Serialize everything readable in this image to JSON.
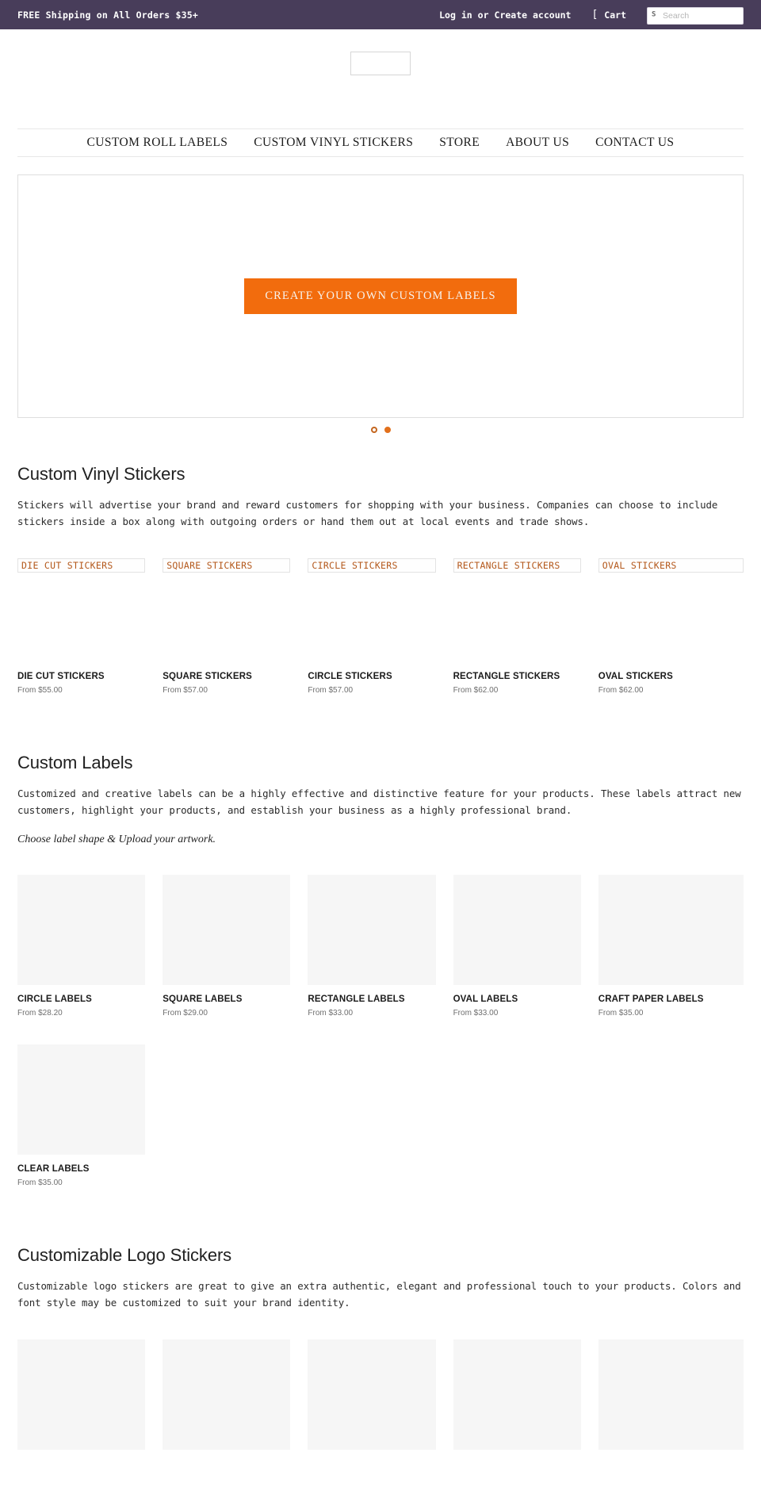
{
  "topbar": {
    "promo": "FREE Shipping on All Orders $35+",
    "login_label": "Log in",
    "separator": "or",
    "create_account_label": "Create account",
    "cart_icon": "[",
    "cart_label": "Cart",
    "search_placeholder": "Search",
    "search_value": "",
    "search_glyph": "S",
    "bg_color": "#483d5a"
  },
  "header": {
    "logo_alt": ""
  },
  "nav": {
    "items": [
      {
        "label": "CUSTOM ROLL LABELS"
      },
      {
        "label": "CUSTOM VINYL STICKERS"
      },
      {
        "label": "STORE"
      },
      {
        "label": "ABOUT US"
      },
      {
        "label": "CONTACT US"
      }
    ]
  },
  "hero": {
    "cta_label": "CREATE YOUR OWN CUSTOM LABELS",
    "cta_color": "#f26c0d",
    "dots": [
      {
        "active": false
      },
      {
        "active": true
      }
    ]
  },
  "sections": [
    {
      "title": "Custom Vinyl Stickers",
      "body": "Stickers will advertise your brand and reward customers for shopping with your business. Companies can choose to include stickers inside a box along with outgoing orders or hand them out at local events and trade shows.",
      "note": "",
      "tile_style": "broken",
      "products": [
        {
          "alt": "DIE CUT STICKERS",
          "title": "DIE CUT STICKERS",
          "price": "From $55.00"
        },
        {
          "alt": "SQUARE STICKERS",
          "title": "SQUARE STICKERS",
          "price": "From $57.00"
        },
        {
          "alt": "CIRCLE STICKERS",
          "title": "CIRCLE STICKERS",
          "price": "From $57.00"
        },
        {
          "alt": "RECTANGLE STICKERS",
          "title": "RECTANGLE STICKERS",
          "price": "From $62.00"
        },
        {
          "alt": "OVAL STICKERS",
          "title": "OVAL STICKERS",
          "price": "From $62.00"
        }
      ]
    },
    {
      "title": "Custom Labels",
      "body": "Customized and creative labels can be a highly effective and distinctive feature for your products. These labels attract new customers, highlight your products, and establish your business as a highly professional brand.",
      "note": "Choose label shape & Upload your artwork.",
      "tile_style": "grey",
      "products": [
        {
          "alt": "",
          "title": "CIRCLE LABELS",
          "price": "From $28.20"
        },
        {
          "alt": "",
          "title": "SQUARE LABELS",
          "price": "From $29.00"
        },
        {
          "alt": "",
          "title": "RECTANGLE LABELS",
          "price": "From $33.00"
        },
        {
          "alt": "",
          "title": "OVAL LABELS",
          "price": "From $33.00"
        },
        {
          "alt": "",
          "title": "CRAFT PAPER LABELS",
          "price": "From $35.00"
        },
        {
          "alt": "",
          "title": "CLEAR LABELS",
          "price": "From $35.00"
        }
      ]
    },
    {
      "title": "Customizable Logo Stickers",
      "body": "Customizable logo stickers are great to give an extra authentic, elegant and professional touch to your products. Colors and font style may be customized to suit your brand identity.",
      "note": "",
      "tile_style": "grey",
      "products": [
        {
          "alt": "",
          "title": "",
          "price": ""
        },
        {
          "alt": "",
          "title": "",
          "price": ""
        },
        {
          "alt": "",
          "title": "",
          "price": ""
        },
        {
          "alt": "",
          "title": "",
          "price": ""
        },
        {
          "alt": "",
          "title": "",
          "price": ""
        }
      ]
    }
  ]
}
